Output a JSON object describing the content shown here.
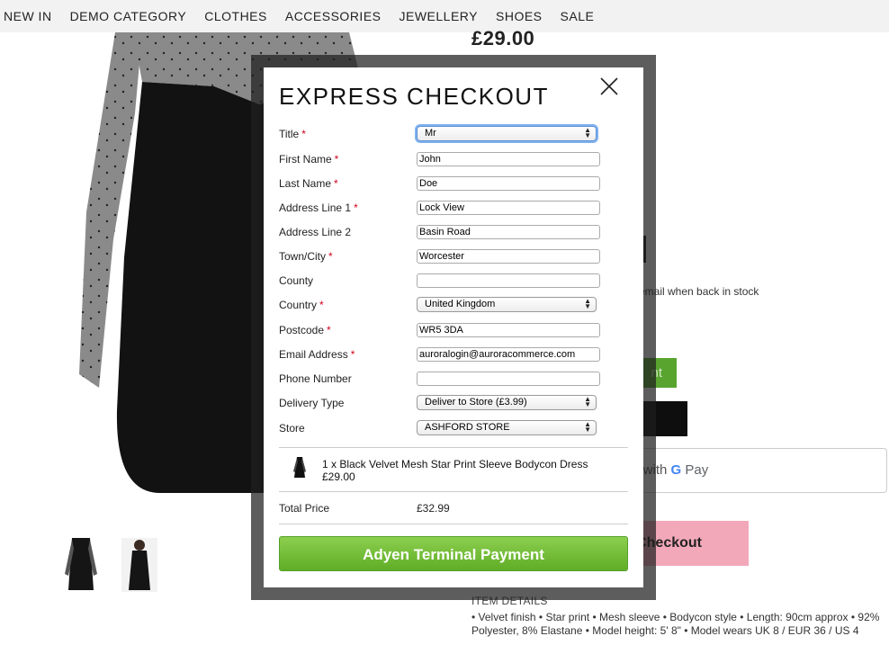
{
  "nav": {
    "items": [
      "NEW IN",
      "DEMO CATEGORY",
      "CLOTHES",
      "ACCESSORIES",
      "JEWELLERY",
      "SHOES",
      "SALE"
    ]
  },
  "product": {
    "price": "£29.00",
    "stock_notice": "n email when back in stock",
    "green_button_text": "nt",
    "gpay_text": "y with",
    "gpay_brand_g": "G",
    "gpay_brand_pay": "Pay",
    "pink_button_text": "Checkout",
    "details_title": "ITEM DETAILS",
    "details_text": "• Velvet finish • Star print • Mesh sleeve • Bodycon style • Length: 90cm approx • 92% Polyester, 8% Elastane • Model height: 5' 8\" • Model wears UK 8 / EUR 36 / US 4"
  },
  "modal": {
    "title": "EXPRESS CHECKOUT",
    "close_icon": "close-icon",
    "required_mark": "*",
    "fields": {
      "title": {
        "label": "Title",
        "value": "Mr"
      },
      "first_name": {
        "label": "First Name",
        "value": "John"
      },
      "last_name": {
        "label": "Last Name",
        "value": "Doe"
      },
      "address1": {
        "label": "Address Line 1",
        "value": "Lock View"
      },
      "address2": {
        "label": "Address Line 2",
        "value": "Basin Road"
      },
      "town": {
        "label": "Town/City",
        "value": "Worcester"
      },
      "county": {
        "label": "County",
        "value": ""
      },
      "country": {
        "label": "Country",
        "value": "United Kingdom"
      },
      "postcode": {
        "label": "Postcode",
        "value": "WR5 3DA"
      },
      "email": {
        "label": "Email Address",
        "value": "auroralogin@auroracommerce.com"
      },
      "phone": {
        "label": "Phone Number",
        "value": ""
      },
      "delivery": {
        "label": "Delivery Type",
        "value": "Deliver to Store (£3.99)"
      },
      "store": {
        "label": "Store",
        "value": "ASHFORD STORE"
      }
    },
    "summary": {
      "line": "1 x Black Velvet Mesh Star Print Sleeve Bodycon Dress",
      "price": "£29.00"
    },
    "total_label": "Total Price",
    "total_value": "£32.99",
    "pay_button": "Adyen Terminal Payment"
  },
  "colors": {
    "pay_green": "#6cbb31",
    "required_red": "#d0021b",
    "pink_accent": "#f2a8b9"
  }
}
